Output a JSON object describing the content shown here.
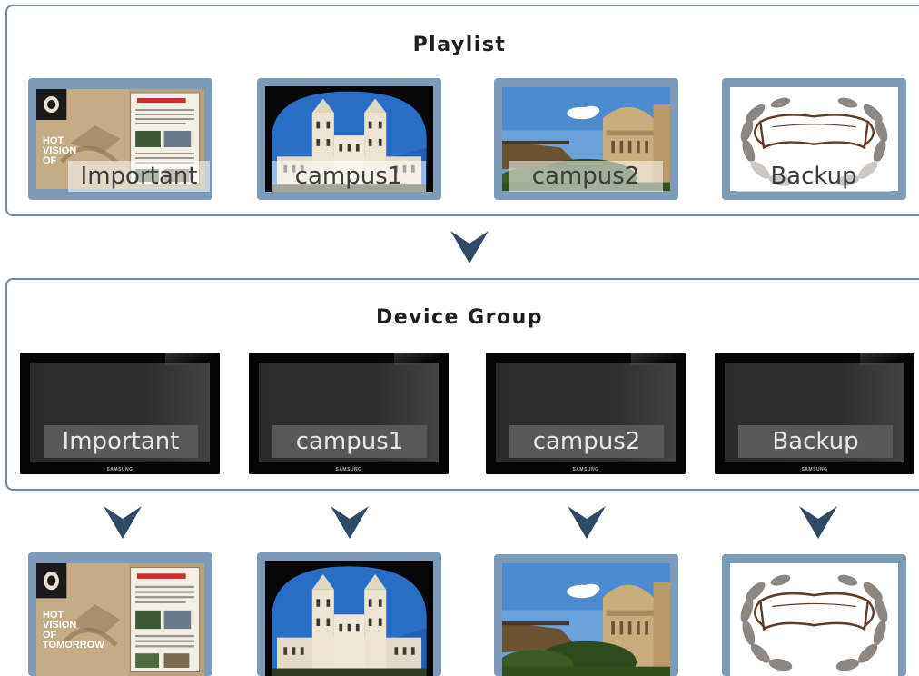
{
  "playlist": {
    "title": "Playlist",
    "items": [
      {
        "label": "Important",
        "image": "poster-hot-vision-of-tomorrow"
      },
      {
        "label": "campus1",
        "image": "photo-gothic-college-building"
      },
      {
        "label": "campus2",
        "image": "photo-rotunda-library-sky"
      },
      {
        "label": "Backup",
        "image": "laurel-wreath-banner-emblem"
      }
    ]
  },
  "device_group": {
    "title": "Device Group",
    "devices": [
      {
        "label": "Important",
        "brand": "SAMSUNG"
      },
      {
        "label": "campus1",
        "brand": "SAMSUNG"
      },
      {
        "label": "campus2",
        "brand": "SAMSUNG"
      },
      {
        "label": "Backup",
        "brand": "SAMSUNG"
      }
    ]
  },
  "poster_text": {
    "line1": "HOT",
    "line2": "VISION",
    "line3": "OF",
    "line4": "TOMORROW",
    "doc_title": "Short & Fables"
  },
  "icons": [
    "down-chevron-arrow-icon"
  ],
  "colors": {
    "panel_border": "#6f8aa3",
    "thumb_frame": "#7d9ab6",
    "arrow": "#2f4a62",
    "tv_body": "#050505"
  }
}
